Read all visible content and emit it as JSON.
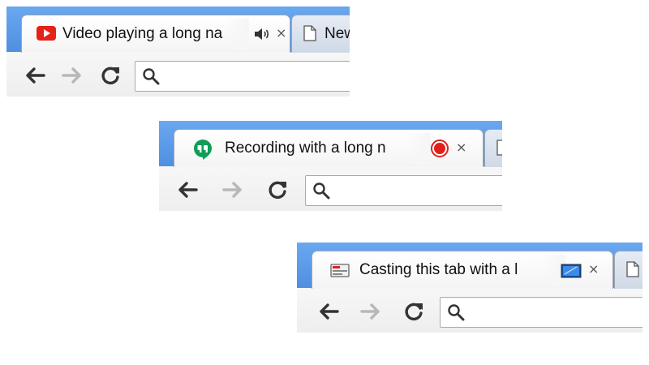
{
  "browsers": [
    {
      "active_tab": {
        "title": "Video playing a long na",
        "favicon": "youtube-icon",
        "indicator": "speaker-icon"
      },
      "next_tab": {
        "title": "New",
        "favicon": "page-icon"
      }
    },
    {
      "active_tab": {
        "title": "Recording with a long n",
        "favicon": "hangouts-icon",
        "indicator": "recording-dot-icon"
      },
      "next_tab": {
        "title": "",
        "favicon": "page-icon"
      }
    },
    {
      "active_tab": {
        "title": "Casting this tab with a l",
        "favicon": "cast-icon",
        "indicator": "tab-capture-icon"
      },
      "next_tab": {
        "title": "",
        "favicon": "page-icon"
      }
    }
  ],
  "tab_close_glyph": "×",
  "colors": {
    "tabstrip": "#5b9be6",
    "youtube": "#e62117",
    "hangouts": "#0f9d58",
    "record": "#e0201b",
    "capture": "#1a66cc"
  },
  "icons": {
    "back": "back-arrow-icon",
    "forward": "forward-arrow-icon",
    "reload": "reload-icon",
    "search": "search-icon"
  }
}
